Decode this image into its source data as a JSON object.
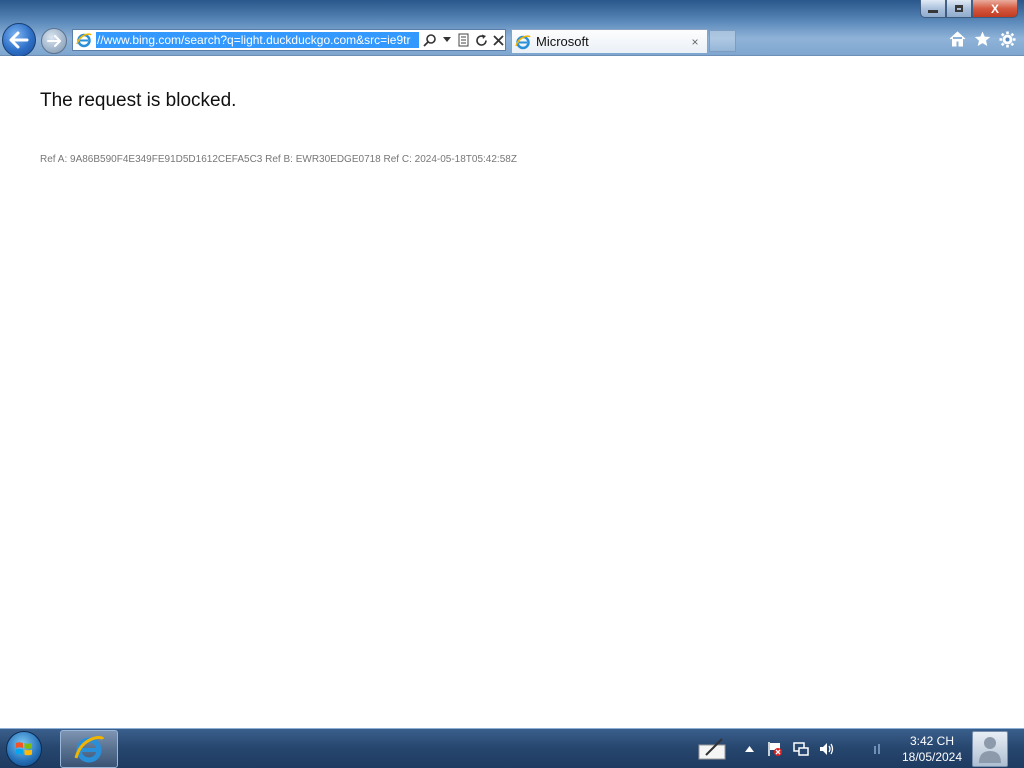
{
  "browser": {
    "address_url": "//www.bing.com/search?q=light.duckduckgo.com&src=ie9tr",
    "tab_title": "Microsoft",
    "tab_close": "×",
    "icons": [
      "back-arrow-icon",
      "forward-arrow-icon",
      "ie-logo-icon",
      "search-icon",
      "compat-view-icon",
      "refresh-icon",
      "stop-icon",
      "home-icon",
      "favorites-star-icon",
      "tools-gear-icon"
    ]
  },
  "window_controls": {
    "close": "X"
  },
  "page": {
    "heading": "The request is blocked.",
    "ref_line": "Ref A: 9A86B590F4E349FE91D5D1612CEFA5C3 Ref B: EWR30EDGE0718 Ref C: 2024-05-18T05:42:58Z"
  },
  "taskbar": {
    "time": "3:42 CH",
    "date": "18/05/2024",
    "tray_icons": [
      "pen-input-icon",
      "show-hidden-icons-arrow",
      "action-center-flag-icon",
      "network-icon",
      "volume-icon"
    ]
  },
  "colors": {
    "selection": "#3399ff",
    "frame": "#5d8bbb",
    "taskbar": "#27476f"
  }
}
